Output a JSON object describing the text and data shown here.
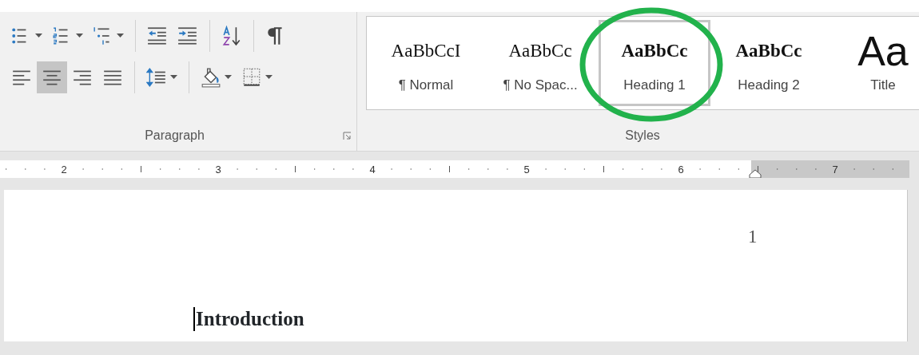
{
  "paragraph_group": {
    "label": "Paragraph",
    "alignment_buttons": [
      {
        "kind": "left",
        "selected": false
      },
      {
        "kind": "center",
        "selected": true
      },
      {
        "kind": "right",
        "selected": false
      },
      {
        "kind": "justify",
        "selected": false
      }
    ]
  },
  "styles_group": {
    "label": "Styles",
    "styles": [
      {
        "kind": "body",
        "preview": "AaBbCcI",
        "label": "¶ Normal",
        "selected": false
      },
      {
        "kind": "body",
        "preview": "AaBbCc",
        "label": "¶ No Spac...",
        "selected": false
      },
      {
        "kind": "heading",
        "preview": "AaBbCc",
        "label": "Heading 1",
        "selected": true
      },
      {
        "kind": "heading",
        "preview": "AaBbCc",
        "label": "Heading 2",
        "selected": false
      },
      {
        "kind": "title",
        "preview": "Aa",
        "label": "Title",
        "selected": false
      }
    ]
  },
  "ruler": {
    "labels": [
      "2",
      "3",
      "4",
      "5",
      "6",
      "7"
    ]
  },
  "document": {
    "page_number": "1",
    "heading": "Introduction"
  }
}
